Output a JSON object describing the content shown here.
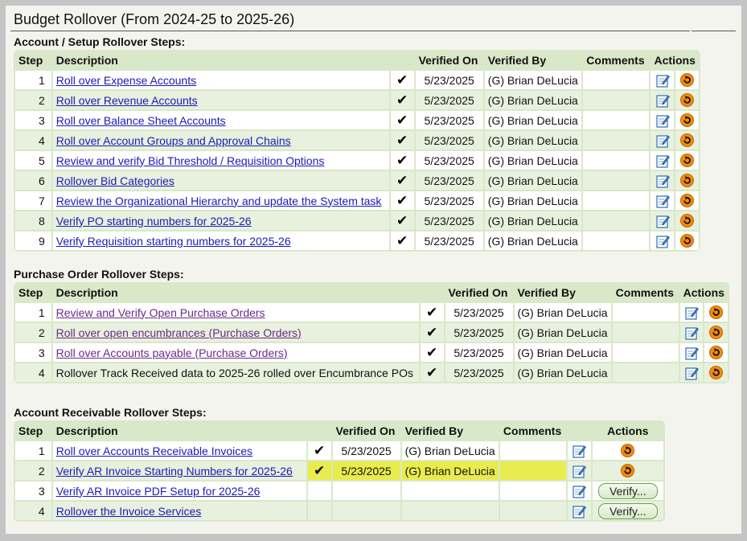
{
  "title": "Budget Rollover (From 2024-25 to 2025-26)",
  "headers": {
    "step": "Step",
    "description": "Description",
    "verified_on": "Verified On",
    "verified_by": "Verified By",
    "comments": "Comments",
    "actions": "Actions"
  },
  "sections": {
    "account": {
      "title": "Account / Setup Rollover Steps:",
      "rows": [
        {
          "step": "1",
          "desc": "Roll over Expense Accounts",
          "check": "✔",
          "date": "5/23/2025",
          "by": "(G) Brian DeLucia",
          "comments": ""
        },
        {
          "step": "2",
          "desc": "Roll over Revenue Accounts",
          "check": "✔",
          "date": "5/23/2025",
          "by": "(G) Brian DeLucia",
          "comments": ""
        },
        {
          "step": "3",
          "desc": "Roll over Balance Sheet Accounts",
          "check": "✔",
          "date": "5/23/2025",
          "by": "(G) Brian DeLucia",
          "comments": ""
        },
        {
          "step": "4",
          "desc": "Roll over Account Groups and Approval Chains",
          "check": "✔",
          "date": "5/23/2025",
          "by": "(G) Brian DeLucia",
          "comments": ""
        },
        {
          "step": "5",
          "desc": "Review and verify Bid Threshold / Requisition Options",
          "check": "✔",
          "date": "5/23/2025",
          "by": "(G) Brian DeLucia",
          "comments": ""
        },
        {
          "step": "6",
          "desc": "Rollover Bid Categories",
          "check": "✔",
          "date": "5/23/2025",
          "by": "(G) Brian DeLucia",
          "comments": ""
        },
        {
          "step": "7",
          "desc": "Review the Organizational Hierarchy and update the System task",
          "check": "✔",
          "date": "5/23/2025",
          "by": "(G) Brian DeLucia",
          "comments": ""
        },
        {
          "step": "8",
          "desc": "Verify PO starting numbers for 2025-26",
          "check": "✔",
          "date": "5/23/2025",
          "by": "(G) Brian DeLucia",
          "comments": ""
        },
        {
          "step": "9",
          "desc": "Verify Requisition starting numbers for 2025-26",
          "check": "✔",
          "date": "5/23/2025",
          "by": "(G) Brian DeLucia",
          "comments": ""
        }
      ]
    },
    "po": {
      "title": "Purchase Order Rollover Steps:",
      "rows": [
        {
          "step": "1",
          "desc": "Review and Verify Open Purchase Orders",
          "check": "✔",
          "date": "5/23/2025",
          "by": "(G) Brian DeLucia",
          "comments": "",
          "link": true
        },
        {
          "step": "2",
          "desc": "Roll over open encumbrances (Purchase Orders)",
          "check": "✔",
          "date": "5/23/2025",
          "by": "(G) Brian DeLucia",
          "comments": "",
          "link": true
        },
        {
          "step": "3",
          "desc": "Roll over Accounts payable (Purchase Orders)",
          "check": "✔",
          "date": "5/23/2025",
          "by": "(G) Brian DeLucia",
          "comments": "",
          "link": true
        },
        {
          "step": "4",
          "desc": "Rollover Track Received data to 2025-26 rolled over Encumbrance POs",
          "check": "✔",
          "date": "5/23/2025",
          "by": "(G) Brian DeLucia",
          "comments": "",
          "link": false
        }
      ]
    },
    "ar": {
      "title": "Account Receivable Rollover Steps:",
      "verify_label": "Verify...",
      "rows": [
        {
          "step": "1",
          "desc": "Roll over Accounts Receivable Invoices",
          "check": "✔",
          "date": "5/23/2025",
          "by": "(G) Brian DeLucia",
          "comments": "",
          "action": "undo"
        },
        {
          "step": "2",
          "desc": "Verify AR Invoice Starting Numbers for 2025-26",
          "check": "✔",
          "date": "5/23/2025",
          "by": "(G) Brian DeLucia",
          "comments": "",
          "action": "undo",
          "highlight": true
        },
        {
          "step": "3",
          "desc": "Verify AR Invoice PDF Setup for 2025-26",
          "check": "",
          "date": "",
          "by": "",
          "comments": "",
          "action": "verify"
        },
        {
          "step": "4",
          "desc": "Rollover the Invoice Services",
          "check": "",
          "date": "",
          "by": "",
          "comments": "",
          "action": "verify"
        }
      ]
    }
  },
  "colors": {
    "header_bg": "#d9e8c9",
    "row_alt": "#e8f1dd",
    "link": "#1a1ab8",
    "visited_link": "#6a2a8a",
    "undo_orange": "#f08a10",
    "highlight": "#e8ec4c"
  },
  "icons": {
    "edit": "edit-note-icon",
    "undo": "undo-icon",
    "check": "checkmark-icon"
  }
}
